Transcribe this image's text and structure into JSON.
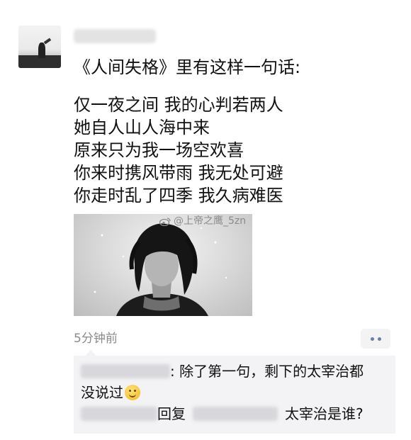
{
  "post": {
    "lines": [
      "《人间失格》里有这样一句话:",
      "仅一夜之间 我的心判若两人",
      "她自人山人海中来",
      "原来只为我一场空欢喜",
      "你来时携风带雨 我无处可避",
      "你走时乱了四季 我久病难医"
    ],
    "watermark": "@上帝之鹰_5zn",
    "time": "5分钟前"
  },
  "comments": [
    {
      "text": ": 除了第一句，剩下的太宰治都"
    },
    {
      "text": "没说过"
    },
    {
      "reply_label": "回复",
      "text": "太宰治是谁?"
    }
  ],
  "icons": {
    "more": "more-dots-icon",
    "emoji": "smile-emoji-icon",
    "weibo": "weibo-logo-icon"
  }
}
